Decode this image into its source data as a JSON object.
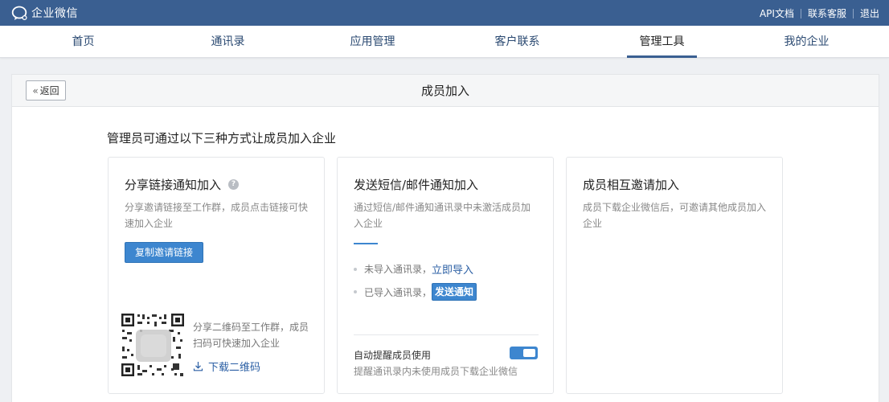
{
  "topbar": {
    "logo_text": "企业微信",
    "links": [
      "API文档",
      "联系客服",
      "退出"
    ]
  },
  "nav": {
    "items": [
      "首页",
      "通讯录",
      "应用管理",
      "客户联系",
      "管理工具",
      "我的企业"
    ],
    "active": "管理工具"
  },
  "panel": {
    "back_label": "返回",
    "title": "成员加入",
    "intro": "管理员可通过以下三种方式让成员加入企业"
  },
  "cards": {
    "share": {
      "title": "分享链接通知加入",
      "desc": "分享邀请链接至工作群，成员点击链接可快速加入企业",
      "button": "复制邀请链接",
      "qr_desc": "分享二维码至工作群，成员扫码可快速加入企业",
      "download": "下载二维码"
    },
    "sms": {
      "title": "发送短信/邮件通知加入",
      "desc": "通过短信/邮件通知通讯录中未激活成员加入企业",
      "row1_text": "未导入通讯录，",
      "row1_link": "立即导入",
      "row2_text": "已导入通讯录，",
      "row2_button": "发送通知",
      "auto_label": "自动提醒成员使用",
      "auto_desc": "提醒通讯录内未使用成员下载企业微信",
      "toggle_on": true
    },
    "invite": {
      "title": "成员相互邀请加入",
      "desc": "成员下载企业微信后，可邀请其他成员加入企业"
    }
  },
  "colors": {
    "topbar": "#3a5f91",
    "accent": "#3d86cf",
    "link": "#2b5fa4"
  }
}
